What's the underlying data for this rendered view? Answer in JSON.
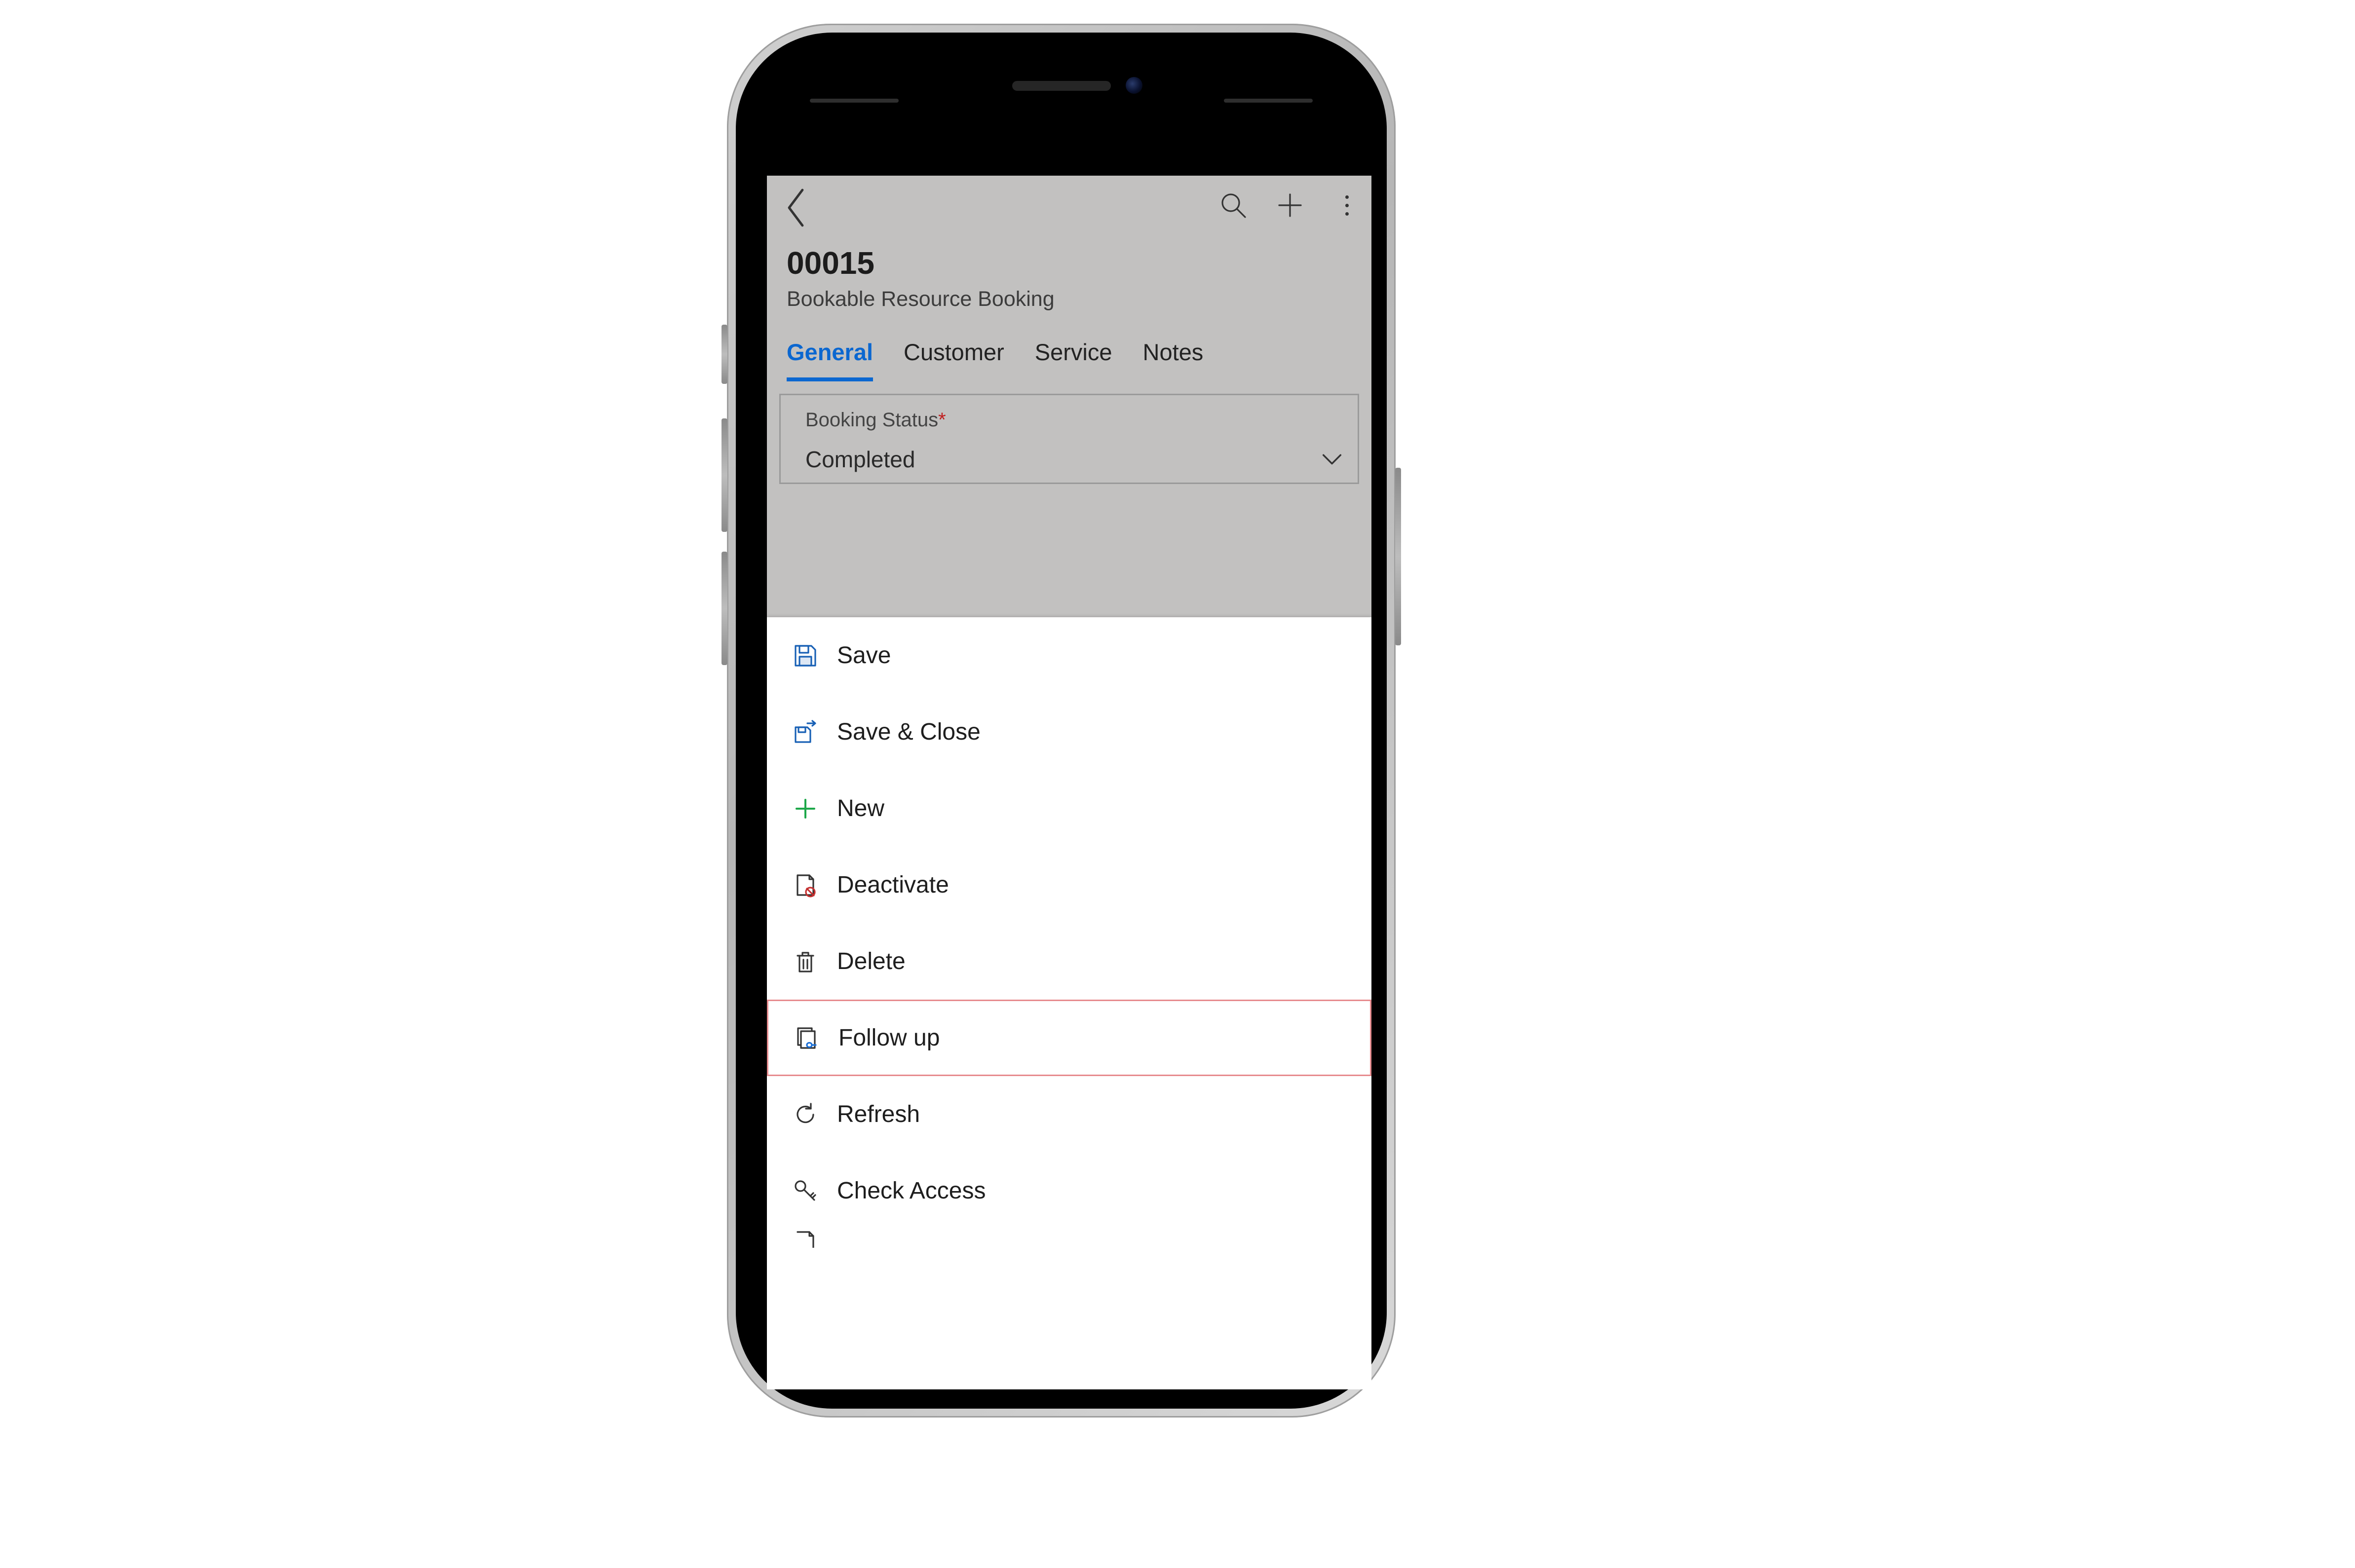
{
  "header": {
    "title": "00015",
    "subtitle": "Bookable Resource Booking"
  },
  "tabs": [
    "General",
    "Customer",
    "Service",
    "Notes"
  ],
  "active_tab": "General",
  "form": {
    "booking_status": {
      "label": "Booking Status",
      "required_mark": "*",
      "value": "Completed"
    }
  },
  "menu": {
    "save": "Save",
    "save_close": "Save & Close",
    "new": "New",
    "deactivate": "Deactivate",
    "delete": "Delete",
    "follow_up": "Follow up",
    "refresh": "Refresh",
    "check_access": "Check Access"
  }
}
